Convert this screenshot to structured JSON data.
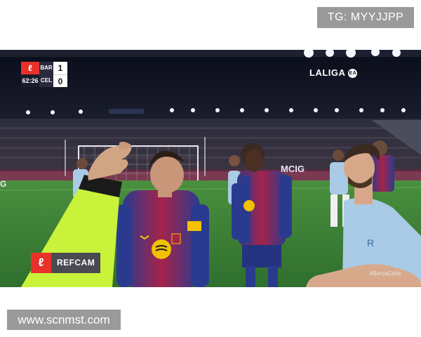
{
  "watermarks": {
    "top": "TG: MYYJJPP",
    "bottom": "www.scnmst.com"
  },
  "broadcast": {
    "scoreboard": {
      "time": "62:26",
      "home_team": "BAR",
      "away_team": "CEL",
      "home_score": "1",
      "away_score": "0"
    },
    "competition": "LALIGA",
    "refcam_label": "REFCAM",
    "hashtag": "#BarçaCelta",
    "ad_board": "MCIG",
    "colors": {
      "laliga_red": "#e8312b",
      "barca_blue": "#2a3b8f",
      "barca_red": "#a5234a",
      "celta_sky": "#a9cbe6",
      "referee_yellow": "#c9f23a",
      "pitch_green": "#3f8a3a"
    }
  }
}
